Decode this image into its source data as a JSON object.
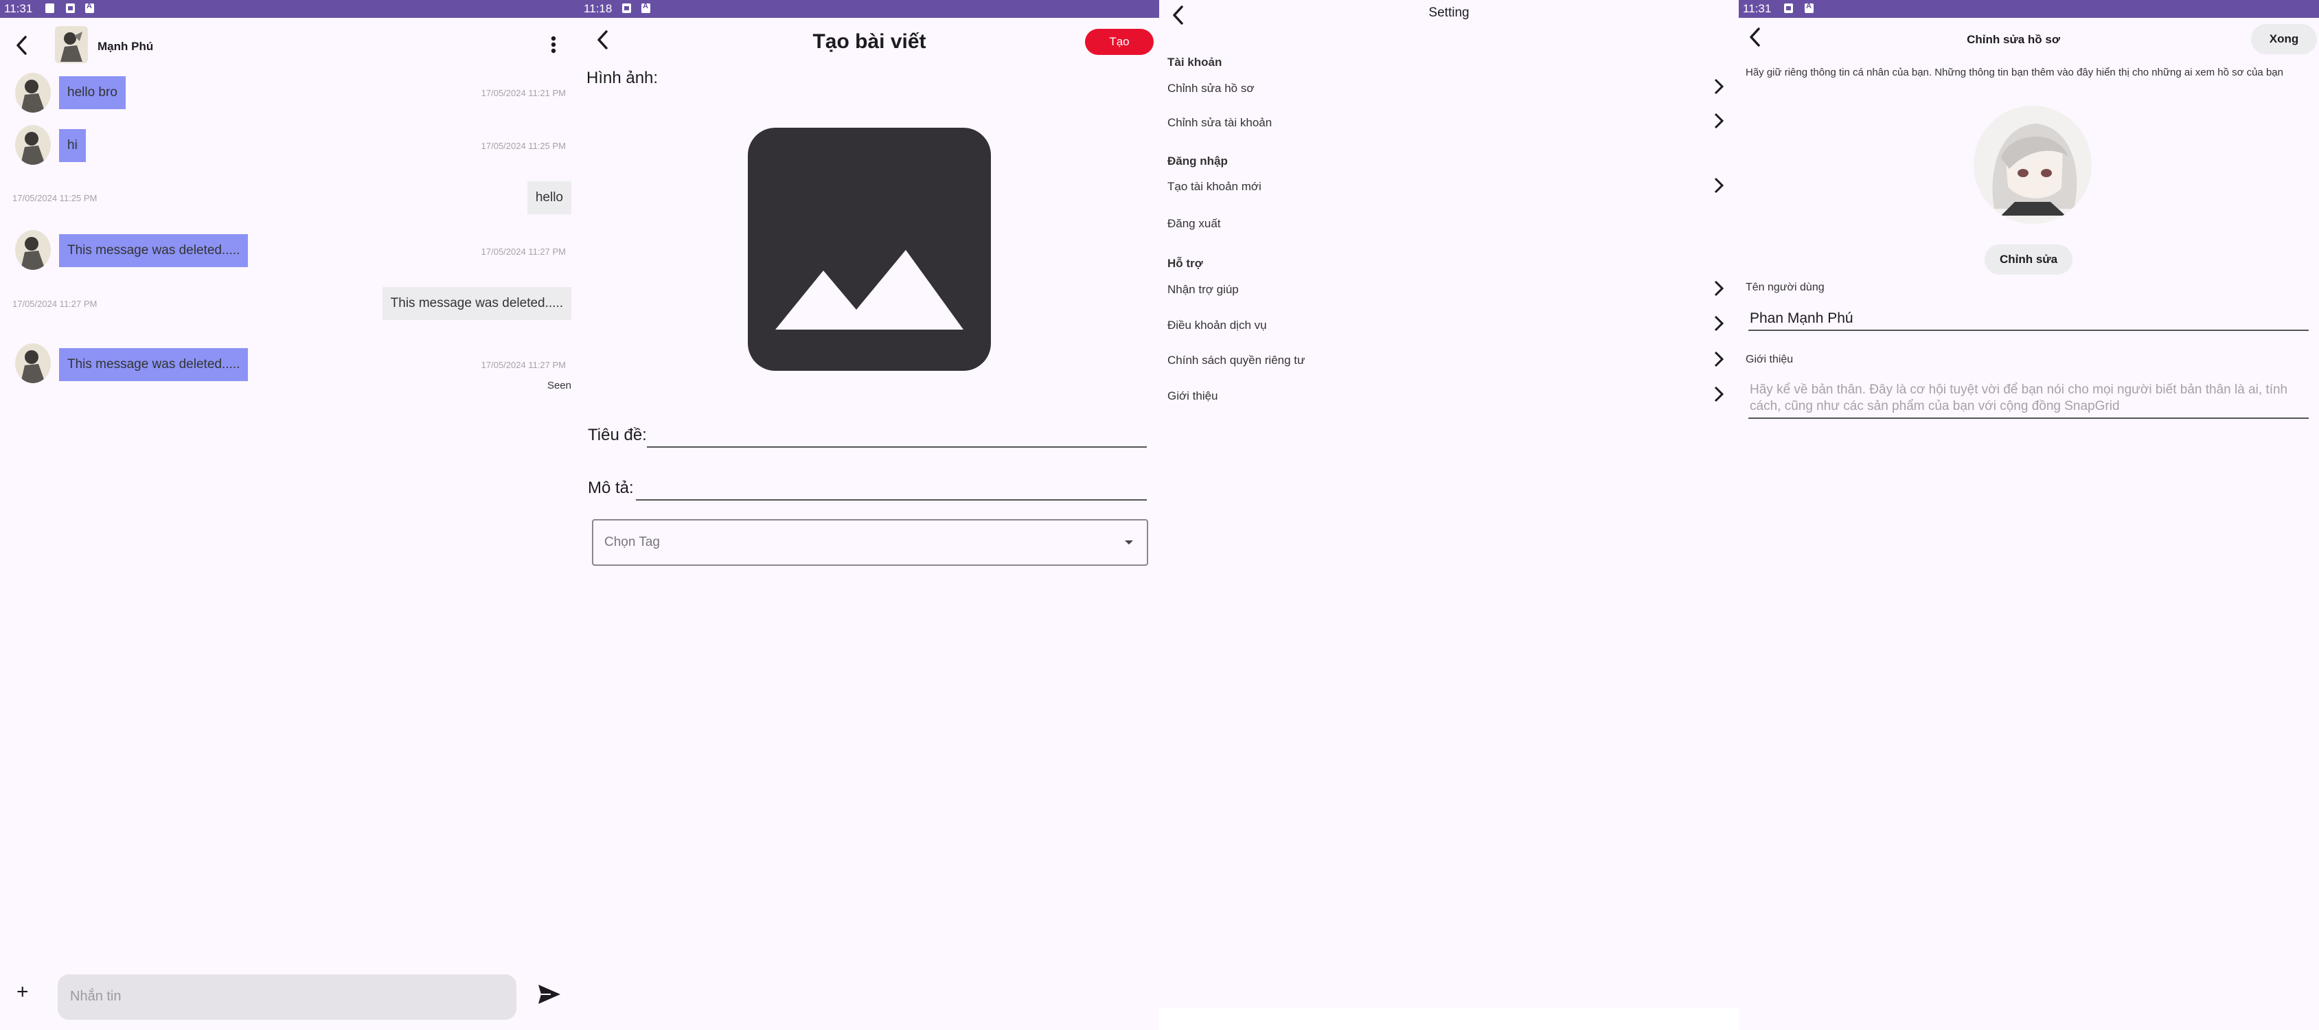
{
  "chat": {
    "status_time": "11:31",
    "contact_name": "Mạnh Phú",
    "messages": [
      {
        "dir": "in",
        "text": "hello bro",
        "time": "17/05/2024 11:21 PM"
      },
      {
        "dir": "in",
        "text": "hi",
        "time": "17/05/2024 11:25 PM"
      },
      {
        "dir": "out",
        "text": "hello",
        "time": "17/05/2024 11:25 PM"
      },
      {
        "dir": "in",
        "text": "This message was deleted.....",
        "time": "17/05/2024 11:27 PM"
      },
      {
        "dir": "out",
        "text": "This message was deleted.....",
        "time": "17/05/2024 11:27 PM"
      },
      {
        "dir": "in",
        "text": "This message was deleted.....",
        "time": "17/05/2024 11:27 PM"
      }
    ],
    "seen": "Seen",
    "input_placeholder": "Nhắn tin",
    "add_label": "+"
  },
  "create_post": {
    "status_time": "11:18",
    "title": "Tạo bài viết",
    "create_button": "Tạo",
    "image_label": "Hình ảnh:",
    "title_label": "Tiêu đề:",
    "desc_label": "Mô tả:",
    "tag_placeholder": "Chọn Tag"
  },
  "settings": {
    "title": "Setting",
    "sections": [
      {
        "title": "Tài khoản",
        "items": [
          "Chỉnh sửa hồ sơ",
          "Chỉnh sửa tài khoản"
        ]
      },
      {
        "title": "Đăng nhập",
        "items": [
          "Tạo tài khoản mới",
          "Đăng xuất"
        ]
      },
      {
        "title": "Hỗ trợ",
        "items": [
          "Nhận trợ giúp",
          "Điều khoản dịch vụ",
          "Chính sách quyền riêng tư",
          "Giới thiệu"
        ]
      }
    ]
  },
  "edit_profile": {
    "status_time": "11:31",
    "title": "Chỉnh sửa hồ sơ",
    "done_button": "Xong",
    "notice": "Hãy giữ riêng thông tin cá nhân của bạn. Những thông tin bạn thêm vào đây hiển thị cho những ai xem hồ sơ của bạn",
    "edit_button": "Chỉnh sửa",
    "username_label": "Tên người dùng",
    "username_value": "Phan Mạnh Phú",
    "intro_label": "Giới thiệu",
    "intro_placeholder": "Hãy kể về bản thân. Đây là cơ hội tuyệt vời để bạn nói cho mọi người biết bản thân là ai, tính cách, cũng như các sản phẩm của bạn với cộng đồng SnapGrid"
  },
  "colors": {
    "status_bar": "#6750a4",
    "background": "#fdf7ff",
    "incoming_bubble": "#8c93f5",
    "outgoing_bubble": "#ececef",
    "create_button": "#e8112d",
    "placeholder_icon": "#333135"
  }
}
